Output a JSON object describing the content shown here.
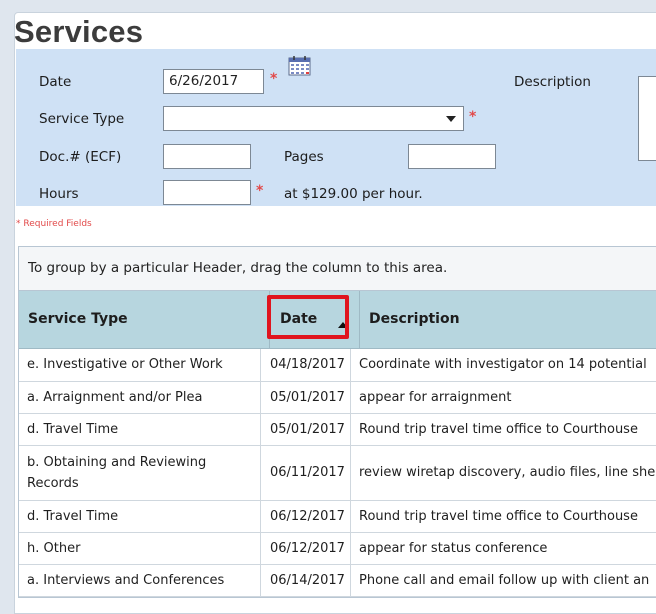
{
  "page": {
    "title": "Services"
  },
  "form": {
    "date_label": "Date",
    "date_value": "6/26/2017",
    "description_label": "Description",
    "service_type_label": "Service Type",
    "service_type_value": "",
    "doc_label": "Doc.# (ECF)",
    "doc_value": "",
    "pages_label": "Pages",
    "pages_value": "",
    "hours_label": "Hours",
    "hours_value": "",
    "rate_text": "at $129.00 per hour.",
    "required_marker": "*",
    "required_note": "* Required Fields"
  },
  "grid": {
    "group_hint": "To group by a particular Header, drag the column to this area.",
    "columns": [
      "Service Type",
      "Date",
      "Description"
    ],
    "sort_column": "Date",
    "sort_direction": "ascending",
    "highlight_color": "#e0141e",
    "rows": [
      {
        "service_type": "e. Investigative or Other Work",
        "date": "04/18/2017",
        "description": "Coordinate with investigator on 14 potential"
      },
      {
        "service_type": "a. Arraignment and/or Plea",
        "date": "05/01/2017",
        "description": "appear for arraignment"
      },
      {
        "service_type": "d. Travel Time",
        "date": "05/01/2017",
        "description": "Round trip travel time office to Courthouse"
      },
      {
        "service_type": "b. Obtaining and Reviewing Records",
        "date": "06/11/2017",
        "description": "review wiretap discovery, audio files, line she"
      },
      {
        "service_type": "d. Travel Time",
        "date": "06/12/2017",
        "description": "Round trip travel time office to Courthouse"
      },
      {
        "service_type": "h. Other",
        "date": "06/12/2017",
        "description": "appear for status conference"
      },
      {
        "service_type": "a. Interviews and Conferences",
        "date": "06/14/2017",
        "description": "Phone call and email follow up with client an"
      }
    ]
  },
  "icons": {
    "calendar": "calendar-icon",
    "dropdown": "chevron-down-icon",
    "sort": "sort-ascending-icon"
  },
  "colors": {
    "form_bg": "#cfe1f5",
    "header_bg": "#b7d6df",
    "required": "#e24a4a"
  }
}
